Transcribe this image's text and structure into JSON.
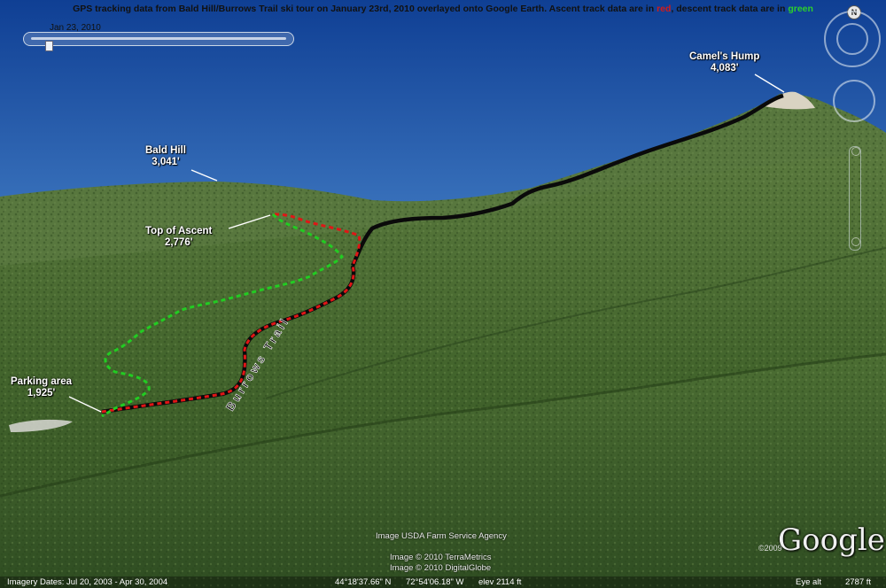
{
  "caption": {
    "part1": "GPS tracking data from Bald Hill/Burrows Trail ski tour on January 23rd, 2010 overlayed onto Google Earth.  Ascent track data are in ",
    "red_word": "red",
    "part2": ", descent track data are in ",
    "green_word": "green"
  },
  "timeslider": {
    "date": "Jan 23, 2010"
  },
  "compass": {
    "north": "N"
  },
  "labels": {
    "camels_hump": {
      "name": "Camel's Hump",
      "elev": "4,083'"
    },
    "bald_hill": {
      "name": "Bald Hill",
      "elev": "3,041'"
    },
    "top_of_ascent": {
      "name": "Top of Ascent",
      "elev": "2,776'"
    },
    "parking": {
      "name": "Parking area",
      "elev": "1,925'"
    },
    "trail_name": "Burrows Trail"
  },
  "track_colors": {
    "ascent": "#e01616",
    "descent": "#22cc22",
    "trail": "#0a0a0a"
  },
  "credits": {
    "usda": "Image USDA Farm Service Agency",
    "terrametrics": "Image © 2010 TerraMetrics",
    "digitalglobe": "Image © 2010 DigitalGlobe",
    "google": "Google",
    "year": "©2009"
  },
  "status": {
    "imagery_dates": "Imagery Dates: Jul 20, 2003 - Apr 30, 2004",
    "lat": "44°18'37.66\" N",
    "lon": "72°54'06.18\" W",
    "elev": "elev  2114 ft",
    "eye_alt_label": "Eye alt",
    "eye_alt": "2787 ft"
  }
}
